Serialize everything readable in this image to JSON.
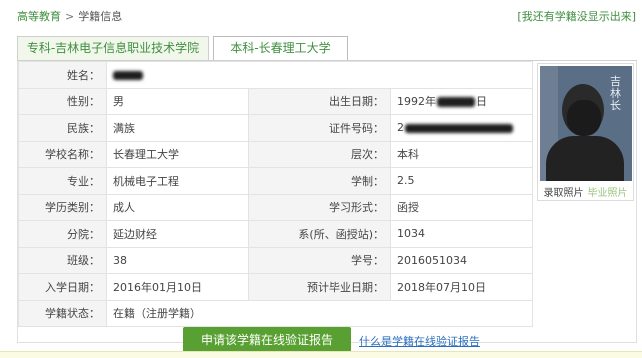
{
  "breadcrumb": {
    "home": "高等教育",
    "separator": ">",
    "current": "学籍信息"
  },
  "top_link": "[我还有学籍没显示出来]",
  "tabs": [
    {
      "label": "专科-吉林电子信息职业技术学院"
    },
    {
      "label": "本科-长春理工大学",
      "active": true
    }
  ],
  "record": {
    "name_label": "姓名：",
    "gender_label": "性别：",
    "gender": "男",
    "birth_label": "出生日期：",
    "birth_prefix": "1992年",
    "birth_suffix": "日",
    "ethnicity_label": "民族：",
    "ethnicity": "满族",
    "id_label": "证件号码：",
    "id_prefix": "2",
    "school_label": "学校名称：",
    "school": "长春理工大学",
    "level_label": "层次：",
    "level": "本科",
    "major_label": "专业：",
    "major": "机械电子工程",
    "duration_label": "学制：",
    "duration": "2.5",
    "edu_type_label": "学历类别：",
    "edu_type": "成人",
    "study_form_label": "学习形式：",
    "study_form": "函授",
    "branch_label": "分院：",
    "branch": "延边财经",
    "dept_label": "系(所、函授站)：",
    "dept": "1034",
    "class_label": "班级：",
    "class": "38",
    "student_no_label": "学号：",
    "student_no": "2016051034",
    "enroll_label": "入学日期：",
    "enroll_date": "2016年01月10日",
    "grad_label": "预计毕业日期：",
    "grad_date": "2018年07月10日",
    "status_label": "学籍状态：",
    "status": "在籍（注册学籍）"
  },
  "photo": {
    "banner_text": "吉林长",
    "capture_label": "录取照片",
    "grad_label": "毕业照片"
  },
  "actions": {
    "verify_button": "申请该学籍在线验证报告",
    "help_link": "什么是学籍在线验证报告"
  },
  "colors": {
    "accent_green": "#58a032",
    "link_green": "#3f8f3f",
    "link_blue": "#2a6fbf"
  }
}
